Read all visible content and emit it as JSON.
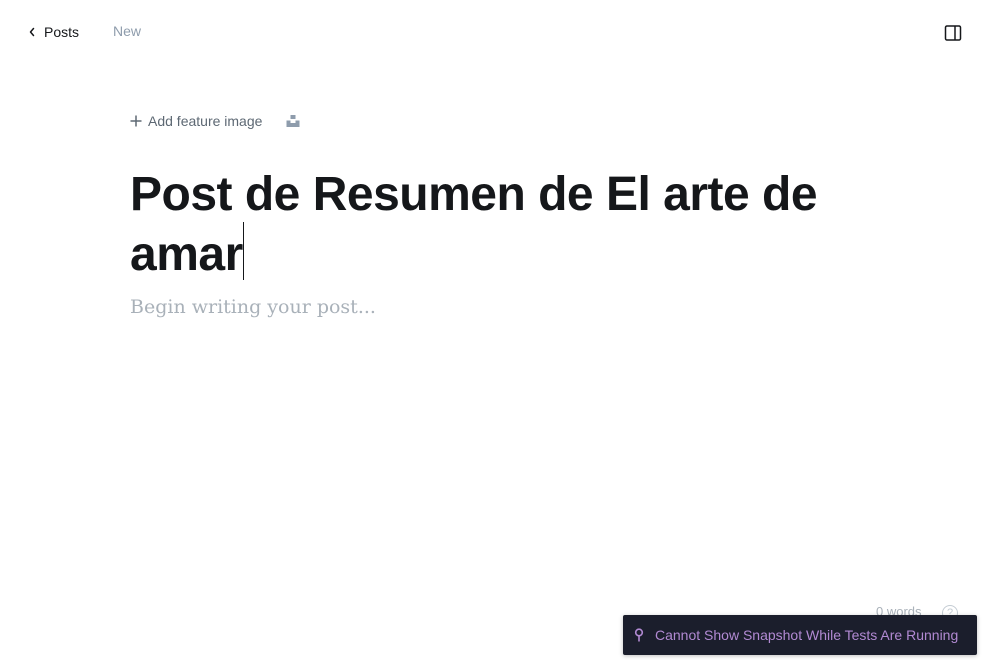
{
  "header": {
    "back_label": "Posts",
    "status": "New"
  },
  "editor": {
    "add_feature_image_label": "Add feature image",
    "title": "Post de Resumen de El arte de amar",
    "body_placeholder": "Begin writing your post..."
  },
  "footer": {
    "word_count": "0 words",
    "help_label": "?"
  },
  "toast": {
    "message": "Cannot Show Snapshot While Tests Are Running"
  },
  "icons": {
    "back": "chevron-left-icon",
    "sidebar": "sidebar-toggle-icon",
    "plus": "plus-icon",
    "unsplash": "unsplash-icon",
    "help": "question-icon",
    "toast": "pin-icon"
  },
  "colors": {
    "text": "#15171a",
    "muted": "#8e9cac",
    "placeholder": "#a9b1b9",
    "toast_bg": "#1b1e2c",
    "toast_text": "#b28ad3"
  }
}
